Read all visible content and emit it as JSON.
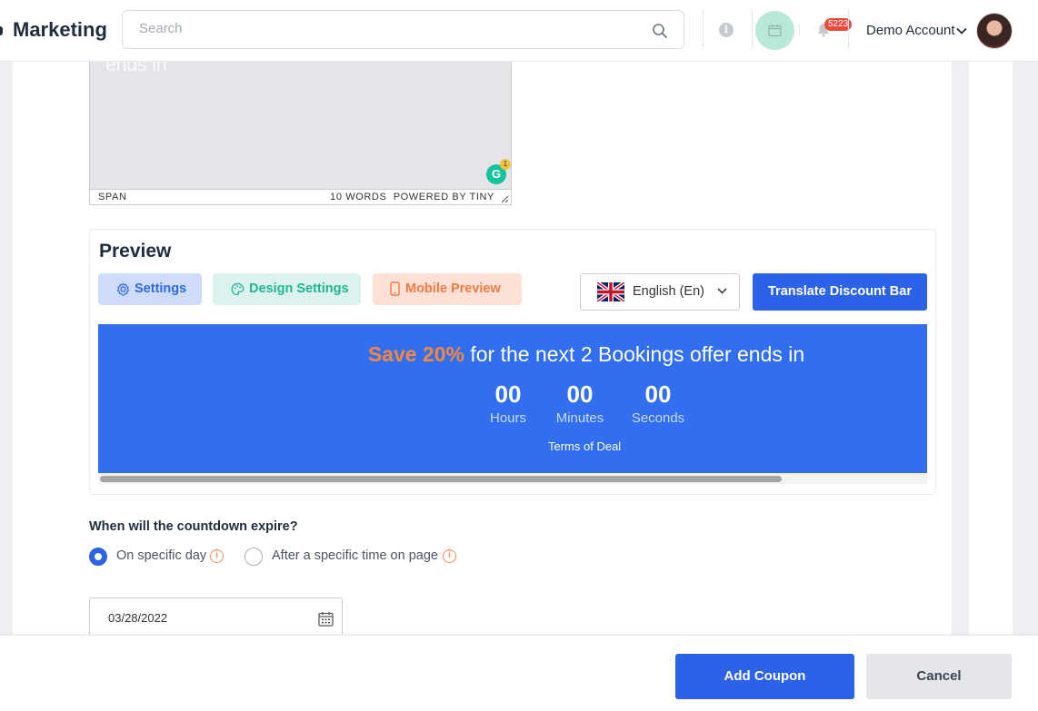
{
  "header": {
    "app_title": "Marketing",
    "search_placeholder": "Search",
    "notification_count": "5223",
    "account_name": "Demo Account",
    "icons": [
      "search-icon",
      "info-icon",
      "calendar-icon",
      "bell-icon",
      "chevron-down-icon",
      "avatar"
    ]
  },
  "editor": {
    "content_text": "ends in",
    "status_left": "SPAN",
    "status_right": "10 WORDS  POWERED BY TINY",
    "grammarly_letter": "G",
    "grammarly_count": "1"
  },
  "preview": {
    "title": "Preview",
    "buttons": {
      "settings": "Settings",
      "design_settings": "Design Settings",
      "mobile_preview": "Mobile Preview",
      "translate": "Translate Discount Bar"
    },
    "language": "English (En)",
    "discount_bar": {
      "save_text": "Save 20%",
      "rest_text": " for the next 2 Bookings offer ends in",
      "countdown": [
        {
          "value": "00",
          "label": "Hours"
        },
        {
          "value": "00",
          "label": "Minutes"
        },
        {
          "value": "00",
          "label": "Seconds"
        }
      ],
      "terms": "Terms of Deal"
    }
  },
  "expiry": {
    "question": "When will the countdown expire?",
    "options": [
      {
        "label": "On specific day",
        "selected": true
      },
      {
        "label": "After a specific time on page",
        "selected": false
      }
    ],
    "date_value": "03/28/2022"
  },
  "footer": {
    "add_label": "Add Coupon",
    "cancel_label": "Cancel"
  },
  "colors": {
    "primary": "#2b62e8",
    "bar_bg": "#316ff0",
    "save_accent": "#f5883d",
    "design_green": "#23b396",
    "mobile_orange": "#ef7c43",
    "badge_red": "#e74c3c"
  }
}
